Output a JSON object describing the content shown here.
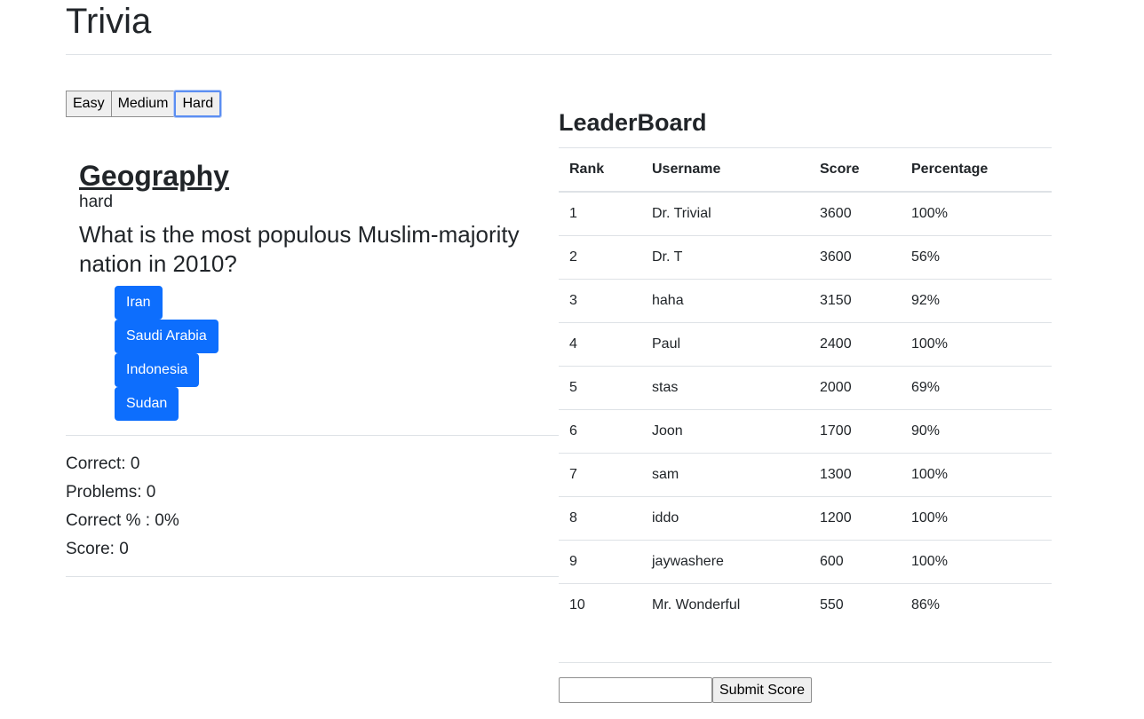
{
  "app": {
    "title": "Trivia"
  },
  "difficulty": {
    "options": [
      "Easy",
      "Medium",
      "Hard"
    ],
    "selected": "Hard"
  },
  "question": {
    "category": "Geography",
    "difficulty": "hard",
    "text": "What is the most populous Muslim-majority nation in 2010?",
    "answers": [
      "Iran",
      "Saudi Arabia",
      "Indonesia",
      "Sudan"
    ]
  },
  "stats": {
    "correct": "Correct: 0",
    "problems": "Problems: 0",
    "percent": "Correct % : 0%",
    "score": "Score: 0"
  },
  "leaderboard": {
    "title": "LeaderBoard",
    "columns": [
      "Rank",
      "Username",
      "Score",
      "Percentage"
    ],
    "rows": [
      [
        "1",
        "Dr. Trivial",
        "3600",
        "100%"
      ],
      [
        "2",
        "Dr. T",
        "3600",
        "56%"
      ],
      [
        "3",
        "haha",
        "3150",
        "92%"
      ],
      [
        "4",
        "Paul",
        "2400",
        "100%"
      ],
      [
        "5",
        "stas",
        "2000",
        "69%"
      ],
      [
        "6",
        "Joon",
        "1700",
        "90%"
      ],
      [
        "7",
        "sam",
        "1300",
        "100%"
      ],
      [
        "8",
        "iddo",
        "1200",
        "100%"
      ],
      [
        "9",
        "jaywashere",
        "600",
        "100%"
      ],
      [
        "10",
        "Mr. Wonderful",
        "550",
        "86%"
      ]
    ]
  },
  "submit": {
    "input_value": "",
    "button_label": "Submit Score"
  },
  "colors": {
    "primary": "#0d6efd",
    "focus_ring": "#5b8ef2"
  }
}
